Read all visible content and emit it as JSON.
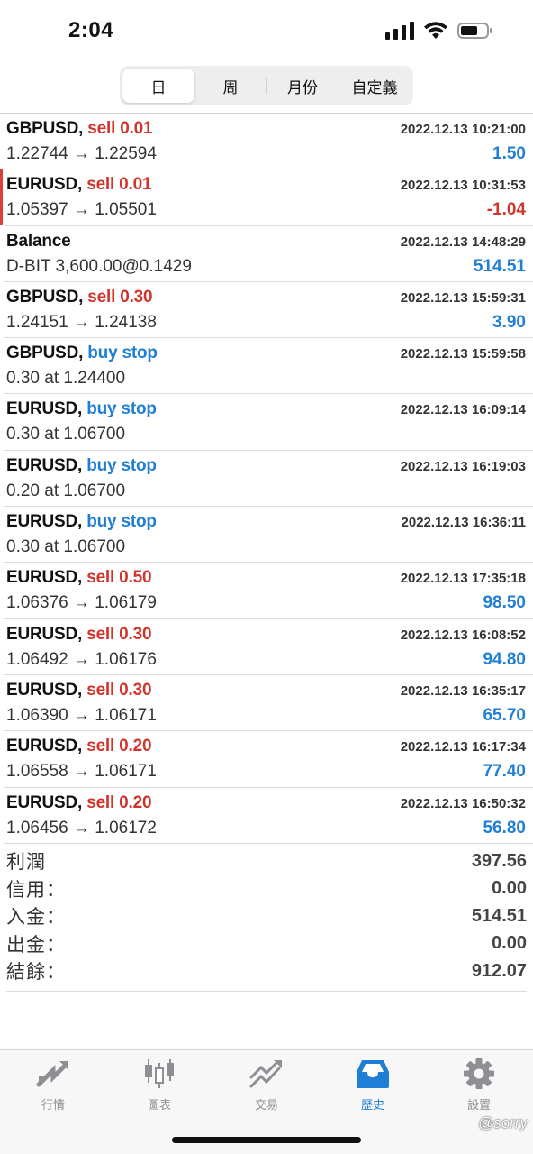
{
  "status": {
    "time": "2:04"
  },
  "tabs_period": [
    "日",
    "周",
    "月份",
    "自定義"
  ],
  "history": [
    {
      "symbol": "GBPUSD,",
      "action": "sell 0.01",
      "side": "sell",
      "time": "2022.12.13 10:21:00",
      "prices": "1.22744 → 1.22594",
      "profit": "1.50",
      "sign": "pos",
      "accent": false
    },
    {
      "symbol": "EURUSD,",
      "action": "sell 0.01",
      "side": "sell",
      "time": "2022.12.13 10:31:53",
      "prices": "1.05397 → 1.05501",
      "profit": "-1.04",
      "sign": "neg",
      "accent": true
    },
    {
      "symbol": "Balance",
      "action": "",
      "side": "",
      "time": "2022.12.13 14:48:29",
      "prices": "D-BIT 3,600.00@0.1429",
      "profit": "514.51",
      "sign": "pos",
      "accent": false
    },
    {
      "symbol": "GBPUSD,",
      "action": "sell 0.30",
      "side": "sell",
      "time": "2022.12.13 15:59:31",
      "prices": "1.24151 → 1.24138",
      "profit": "3.90",
      "sign": "pos",
      "accent": false
    },
    {
      "symbol": "GBPUSD,",
      "action": "buy stop",
      "side": "buy",
      "time": "2022.12.13 15:59:58",
      "prices": "0.30 at 1.24400",
      "profit": "",
      "sign": "pos",
      "accent": false
    },
    {
      "symbol": "EURUSD,",
      "action": "buy stop",
      "side": "buy",
      "time": "2022.12.13 16:09:14",
      "prices": "0.30 at 1.06700",
      "profit": "",
      "sign": "pos",
      "accent": false
    },
    {
      "symbol": "EURUSD,",
      "action": "buy stop",
      "side": "buy",
      "time": "2022.12.13 16:19:03",
      "prices": "0.20 at 1.06700",
      "profit": "",
      "sign": "pos",
      "accent": false
    },
    {
      "symbol": "EURUSD,",
      "action": "buy stop",
      "side": "buy",
      "time": "2022.12.13 16:36:11",
      "prices": "0.30 at 1.06700",
      "profit": "",
      "sign": "pos",
      "accent": false
    },
    {
      "symbol": "EURUSD,",
      "action": "sell 0.50",
      "side": "sell",
      "time": "2022.12.13 17:35:18",
      "prices": "1.06376 → 1.06179",
      "profit": "98.50",
      "sign": "pos",
      "accent": false
    },
    {
      "symbol": "EURUSD,",
      "action": "sell 0.30",
      "side": "sell",
      "time": "2022.12.13 16:08:52",
      "prices": "1.06492 → 1.06176",
      "profit": "94.80",
      "sign": "pos",
      "accent": false
    },
    {
      "symbol": "EURUSD,",
      "action": "sell 0.30",
      "side": "sell",
      "time": "2022.12.13 16:35:17",
      "prices": "1.06390 → 1.06171",
      "profit": "65.70",
      "sign": "pos",
      "accent": false
    },
    {
      "symbol": "EURUSD,",
      "action": "sell 0.20",
      "side": "sell",
      "time": "2022.12.13 16:17:34",
      "prices": "1.06558 → 1.06171",
      "profit": "77.40",
      "sign": "pos",
      "accent": false
    },
    {
      "symbol": "EURUSD,",
      "action": "sell 0.20",
      "side": "sell",
      "time": "2022.12.13 16:50:32",
      "prices": "1.06456 → 1.06172",
      "profit": "56.80",
      "sign": "pos",
      "accent": false
    }
  ],
  "summary": [
    {
      "label": "利潤",
      "value": "397.56"
    },
    {
      "label": "信用：",
      "value": "0.00"
    },
    {
      "label": "入金：",
      "value": "514.51"
    },
    {
      "label": "出金：",
      "value": "0.00"
    },
    {
      "label": "結餘：",
      "value": "912.07"
    }
  ],
  "tabbar": [
    {
      "label": "行情",
      "icon": "quotes-arrows-icon"
    },
    {
      "label": "圖表",
      "icon": "candlestick-chart-icon"
    },
    {
      "label": "交易",
      "icon": "trade-trend-icon"
    },
    {
      "label": "歷史",
      "icon": "history-inbox-icon",
      "active": true
    },
    {
      "label": "設置",
      "icon": "settings-gear-icon"
    }
  ],
  "watermark": "@sorry",
  "colors": {
    "sell": "#d2332b",
    "buy": "#1f7fd6",
    "active_tab": "#1f7fd6"
  }
}
